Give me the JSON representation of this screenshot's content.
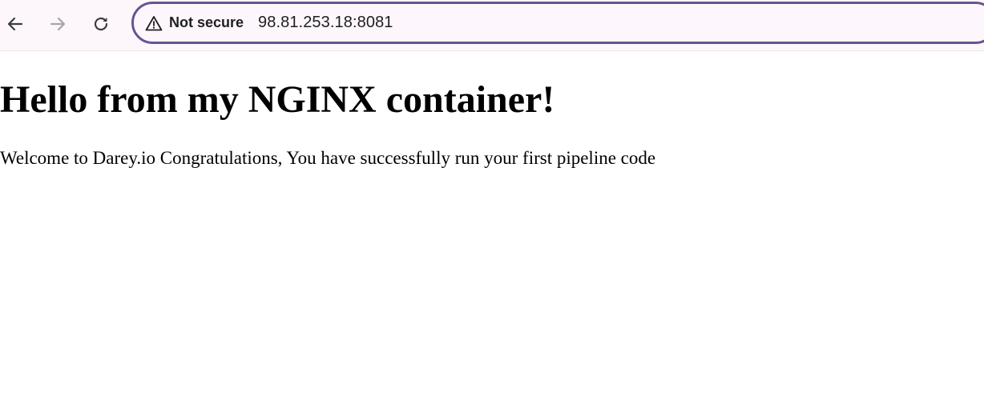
{
  "browser": {
    "address_bar": {
      "security_label": "Not secure",
      "url": "98.81.253.18:8081"
    },
    "icons": {
      "back": "arrow-left-icon",
      "forward": "arrow-right-icon",
      "reload": "reload-icon",
      "security": "warning-triangle-icon"
    },
    "colors": {
      "toolbar_bg": "#fdf7fc",
      "omnibox_border": "#6b5290",
      "icon": "#3c3c3c",
      "icon_disabled": "#a8a4a8"
    }
  },
  "page": {
    "heading": "Hello from my NGINX container!",
    "paragraph": "Welcome to Darey.io Congratulations, You have successfully run your first pipeline code"
  }
}
